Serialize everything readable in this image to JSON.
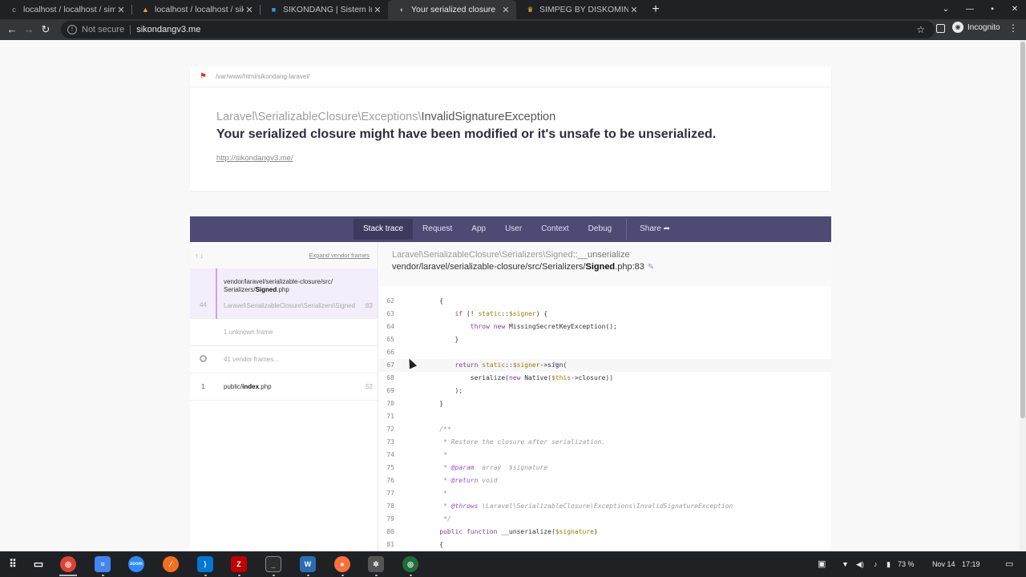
{
  "browser": {
    "tabs": [
      {
        "title": "localhost / localhost / simp",
        "favicon": "c"
      },
      {
        "title": "localhost / localhost / sikon",
        "favicon": "▲"
      },
      {
        "title": "SIKONDANG | Sistem Inform",
        "favicon": "■"
      },
      {
        "title": "Your serialized closure",
        "favicon": "◐"
      },
      {
        "title": "SIMPEG BY DISKOMINFO K",
        "favicon": "♛"
      }
    ],
    "not_secure": "Not secure",
    "url": "sikondangv3.me",
    "profile": "Incognito"
  },
  "error": {
    "path": "/var/www/html/sikondang-laravel/",
    "exception_namespace": "Laravel\\SerializableClosure\\Exceptions\\",
    "exception_class": "InvalidSignatureException",
    "message": "Your serialized closure might have been modified or it's unsafe to be unserialized.",
    "url": "http://sikondangv3.me/"
  },
  "nav": {
    "stack_trace": "Stack trace",
    "request": "Request",
    "app": "App",
    "user": "User",
    "context": "Context",
    "debug": "Debug",
    "share": "Share"
  },
  "frames": {
    "expand": "Expand vendor frames",
    "selected": {
      "number": "44",
      "file_dir": "vendor/laravel/serializable-closure/src/",
      "file_dir2": "Serializers/",
      "file_name": "Signed",
      "file_ext": ".php",
      "class": "Laravel\\SerializableClosure\\Serializers\\Signed",
      "line": ":83"
    },
    "unknown": "1 unknown frame",
    "vendor": "41 vendor frames...",
    "last": {
      "number": "1",
      "file_dir": "public/",
      "file_name": "index",
      "file_ext": ".php",
      "line": "52"
    }
  },
  "code": {
    "class": "Laravel\\SerializableClosure\\Serializers\\Signed",
    "method": "::__unserialize",
    "file_path": "vendor/laravel/serializable-closure/src/Serializers/",
    "file_name": "Signed",
    "file_suffix": ".php:83",
    "lines": [
      {
        "n": "62",
        "html": "    {"
      },
      {
        "n": "63",
        "html": "        <span class=\"k\">if</span> (! <span class=\"s\">static</span>::<span class=\"s\">$signer</span>) {"
      },
      {
        "n": "64",
        "html": "            <span class=\"k\">throw new</span> MissingSecretKeyException();"
      },
      {
        "n": "65",
        "html": "        }"
      },
      {
        "n": "66",
        "html": ""
      },
      {
        "n": "67",
        "html": "        <span class=\"k\">return</span> <span class=\"s\">static</span>::<span class=\"s\">$signer</span>->sign(",
        "hl": true
      },
      {
        "n": "68",
        "html": "            serialize(<span class=\"k\">new</span> Native(<span class=\"s\">$this</span>->closure))"
      },
      {
        "n": "69",
        "html": "        );"
      },
      {
        "n": "70",
        "html": "    }"
      },
      {
        "n": "71",
        "html": ""
      },
      {
        "n": "72",
        "html": "    <span class=\"c\">/**</span>"
      },
      {
        "n": "73",
        "html": "<span class=\"c\">     * Restore the closure after serialization.</span>"
      },
      {
        "n": "74",
        "html": "<span class=\"c\">     *</span>"
      },
      {
        "n": "75",
        "html": "<span class=\"c\">     * </span><span class=\"t\">@param</span><span class=\"c\">  array  $signature</span>"
      },
      {
        "n": "76",
        "html": "<span class=\"c\">     * </span><span class=\"t\">@return</span><span class=\"c\"> void</span>"
      },
      {
        "n": "77",
        "html": "<span class=\"c\">     *</span>"
      },
      {
        "n": "78",
        "html": "<span class=\"c\">     * </span><span class=\"t\">@throws</span><span class=\"c\"> \\Laravel\\SerializableClosure\\Exceptions\\InvalidSignatureException</span>"
      },
      {
        "n": "79",
        "html": "<span class=\"c\">     */</span>"
      },
      {
        "n": "80",
        "html": "    <span class=\"k\">public function</span> __unserialize(<span class=\"s\">$signature</span>)"
      },
      {
        "n": "81",
        "html": "    {"
      }
    ]
  },
  "taskbar": {
    "battery": "73 %",
    "date": "Nov 14",
    "time": "17:19"
  }
}
